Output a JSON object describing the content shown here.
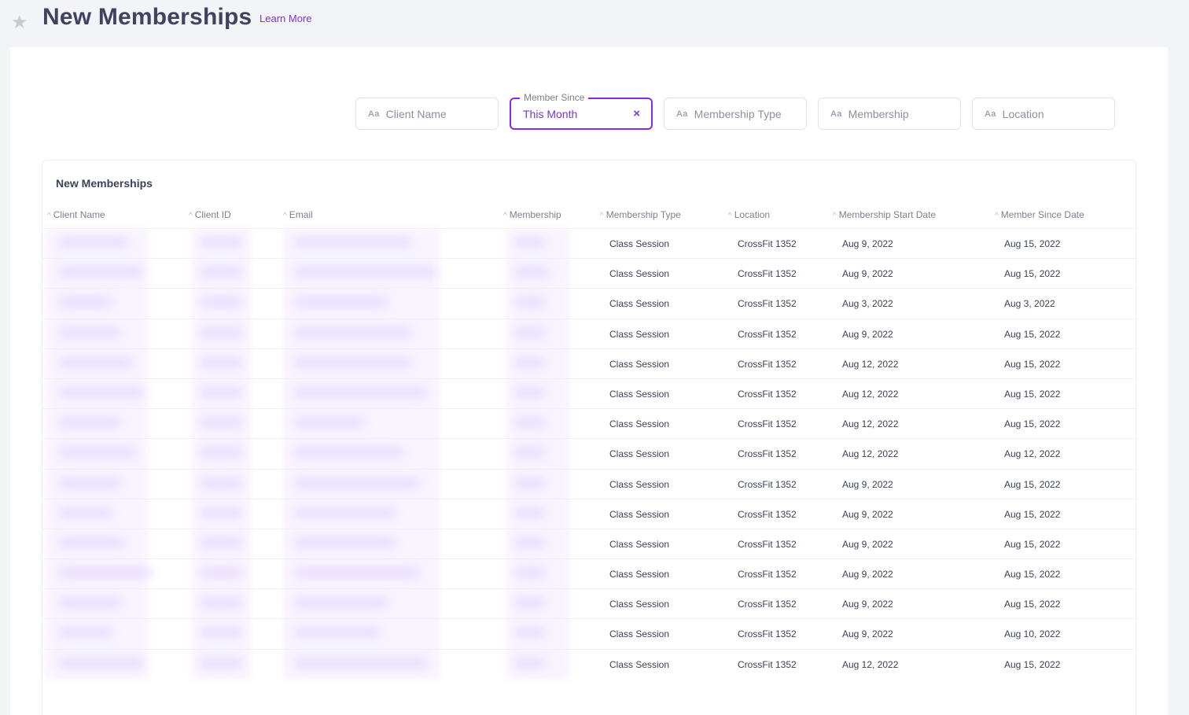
{
  "header": {
    "title": "New Memberships",
    "learn_more": "Learn More",
    "star_icon": "star-icon"
  },
  "filters": [
    {
      "label": "Client Name",
      "prefix": "Aa"
    },
    {
      "label": "Member Since",
      "value": "This Month",
      "active": true,
      "clear": "×"
    },
    {
      "label": "Membership Type",
      "prefix": "Aa"
    },
    {
      "label": "Membership",
      "prefix": "Aa"
    },
    {
      "label": "Location",
      "prefix": "Aa"
    }
  ],
  "table": {
    "title": "New Memberships",
    "columns": [
      "Client Name",
      "Client ID",
      "Email",
      "Membership",
      "Membership Type",
      "Location",
      "Membership Start Date",
      "Member Since Date"
    ],
    "rows": [
      {
        "type": "Class Session",
        "location": "CrossFit 1352",
        "start": "Aug 9, 2022",
        "since": "Aug 15, 2022"
      },
      {
        "type": "Class Session",
        "location": "CrossFit 1352",
        "start": "Aug 9, 2022",
        "since": "Aug 15, 2022"
      },
      {
        "type": "Class Session",
        "location": "CrossFit 1352",
        "start": "Aug 3, 2022",
        "since": "Aug 3, 2022"
      },
      {
        "type": "Class Session",
        "location": "CrossFit 1352",
        "start": "Aug 9, 2022",
        "since": "Aug 15, 2022"
      },
      {
        "type": "Class Session",
        "location": "CrossFit 1352",
        "start": "Aug 12, 2022",
        "since": "Aug 15, 2022"
      },
      {
        "type": "Class Session",
        "location": "CrossFit 1352",
        "start": "Aug 12, 2022",
        "since": "Aug 15, 2022"
      },
      {
        "type": "Class Session",
        "location": "CrossFit 1352",
        "start": "Aug 12, 2022",
        "since": "Aug 15, 2022"
      },
      {
        "type": "Class Session",
        "location": "CrossFit 1352",
        "start": "Aug 12, 2022",
        "since": "Aug 12, 2022"
      },
      {
        "type": "Class Session",
        "location": "CrossFit 1352",
        "start": "Aug 9, 2022",
        "since": "Aug 15, 2022"
      },
      {
        "type": "Class Session",
        "location": "CrossFit 1352",
        "start": "Aug 9, 2022",
        "since": "Aug 15, 2022"
      },
      {
        "type": "Class Session",
        "location": "CrossFit 1352",
        "start": "Aug 9, 2022",
        "since": "Aug 15, 2022"
      },
      {
        "type": "Class Session",
        "location": "CrossFit 1352",
        "start": "Aug 9, 2022",
        "since": "Aug 15, 2022"
      },
      {
        "type": "Class Session",
        "location": "CrossFit 1352",
        "start": "Aug 9, 2022",
        "since": "Aug 15, 2022"
      },
      {
        "type": "Class Session",
        "location": "CrossFit 1352",
        "start": "Aug 9, 2022",
        "since": "Aug 10, 2022"
      },
      {
        "type": "Class Session",
        "location": "CrossFit 1352",
        "start": "Aug 12, 2022",
        "since": "Aug 15, 2022"
      }
    ]
  },
  "colors": {
    "accent": "#8a2be2",
    "link": "#7a35d6",
    "background": "#f3f4f7"
  }
}
